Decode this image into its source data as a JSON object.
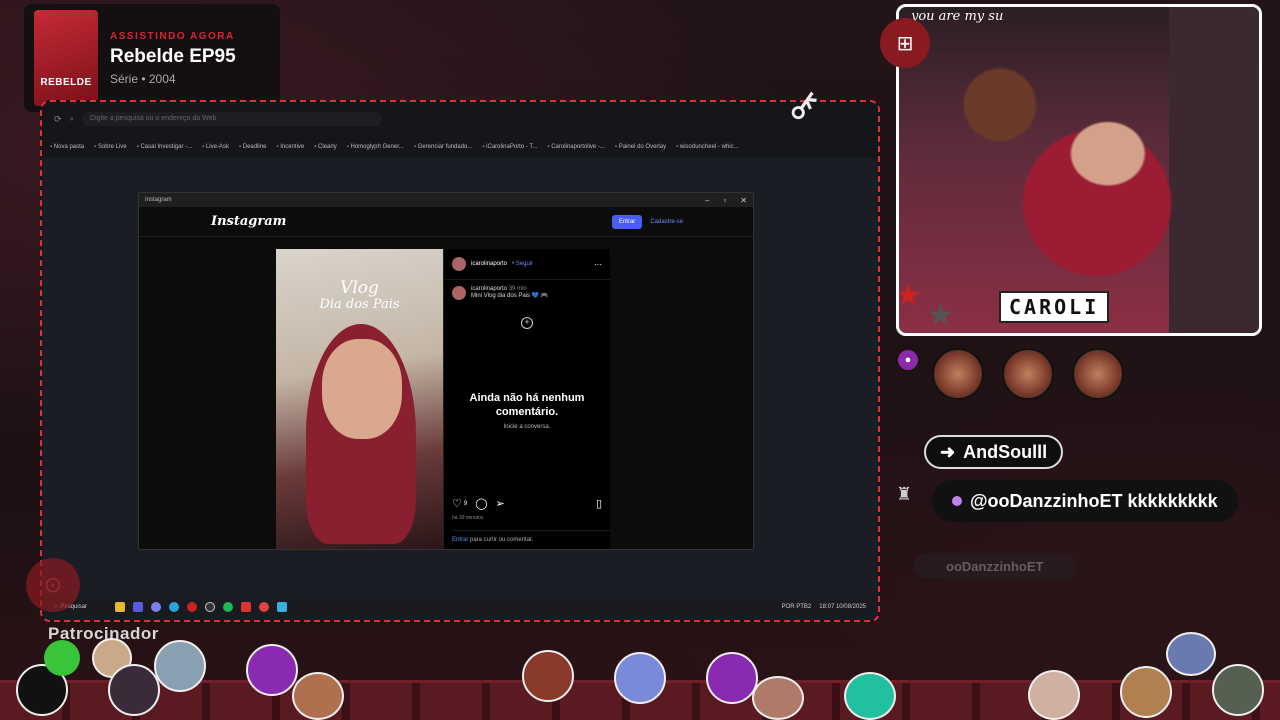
{
  "now_watching": {
    "label": "ASSISTINDO AGORA",
    "title": "Rebelde EP95",
    "meta": "Série • 2004",
    "poster_text": "REBELDE"
  },
  "browser": {
    "address_placeholder": "Digite a pesquisa ou o endereço da Web",
    "bookmarks": [
      "Nova pasta",
      "Sobre Live",
      "Casal Investigar -...",
      "Live-Ask",
      "Deadline",
      "Incentive",
      "Clearly",
      "Homoglyph Gener...",
      "Gerenciar fundado...",
      "iCarolinaPorto - T...",
      "Carolinaportolive -...",
      "Painel do Overlay",
      "wisoduncheel - whic..."
    ]
  },
  "instagram_window": {
    "window_title": "Instagram",
    "logo": "Instagram",
    "login_button": "Entrar",
    "signup_link": "Cadastre-se",
    "post": {
      "media_text_line1": "Vlog",
      "media_text_line2": "Dia dos Pais",
      "author": "icarolinaporto",
      "follow_label": "• Seguir",
      "caption_author": "icarolinaporto",
      "caption_time": "39 min",
      "caption_text": "Mini Vlog dia dos Pais 💙 🎮",
      "no_comments_title": "Ainda não há nenhum comentário.",
      "no_comments_sub": "Inicie a conversa.",
      "likes": "9",
      "ago": "há 39 minutos",
      "login_link": "Entrar",
      "login_rest": " para curtir ou comentar."
    }
  },
  "taskbar": {
    "search_label": "Pesquisar",
    "lang": "POR PTB2",
    "clock": "18:07 10/08/2025"
  },
  "webcam": {
    "top_text": "you are my su",
    "name_label": "CAROLI"
  },
  "overlay": {
    "sponsor_label": "Patrocinador",
    "follow_name": "AndSoulll",
    "chat_message": "@ooDanzzinhoET kkkkkkkkk",
    "ghost_username": "ooDanzzinhoET"
  },
  "colors": {
    "accent_red": "#e0303a",
    "ig_blue": "#4a5df0",
    "seat_red": "#5a1a22"
  },
  "icons": [
    "search-icon",
    "more-icon",
    "plus-circle-icon",
    "heart-icon",
    "comment-icon",
    "share-icon",
    "bookmark-icon",
    "key-icon",
    "user-icon",
    "star-icon",
    "arrow-right-icon"
  ]
}
